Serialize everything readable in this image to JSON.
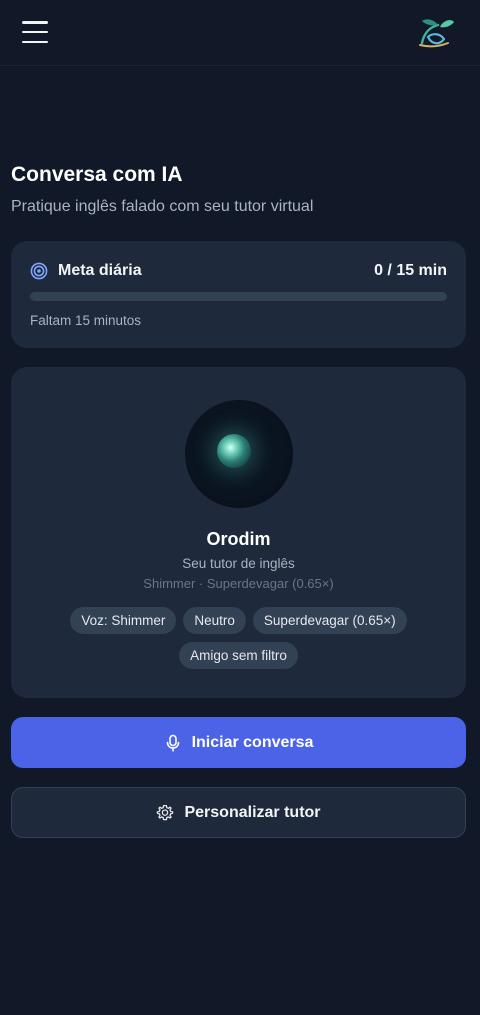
{
  "header": {
    "menu_icon": "hamburger-menu-icon",
    "logo_icon": "leaf-logo-icon"
  },
  "page": {
    "title": "Conversa com IA",
    "subtitle": "Pratique inglês falado com seu tutor virtual"
  },
  "daily_goal": {
    "icon": "target-icon",
    "label": "Meta diária",
    "value": "0 / 15 min",
    "progress_fraction": 0,
    "remaining": "Faltam 15 minutos"
  },
  "tutor": {
    "name": "Orodim",
    "role": "Seu tutor de inglês",
    "meta": "Shimmer · Superdevagar (0.65×)",
    "tags": [
      "Voz: Shimmer",
      "Neutro",
      "Superdevagar (0.65×)",
      "Amigo sem filtro"
    ]
  },
  "actions": {
    "start_label": "Iniciar conversa",
    "start_icon": "microphone-icon",
    "customize_label": "Personalizar tutor",
    "customize_icon": "gear-icon"
  },
  "colors": {
    "background": "#111827",
    "card": "#1e293b",
    "accent": "#4b63e6",
    "tag": "#334155"
  }
}
